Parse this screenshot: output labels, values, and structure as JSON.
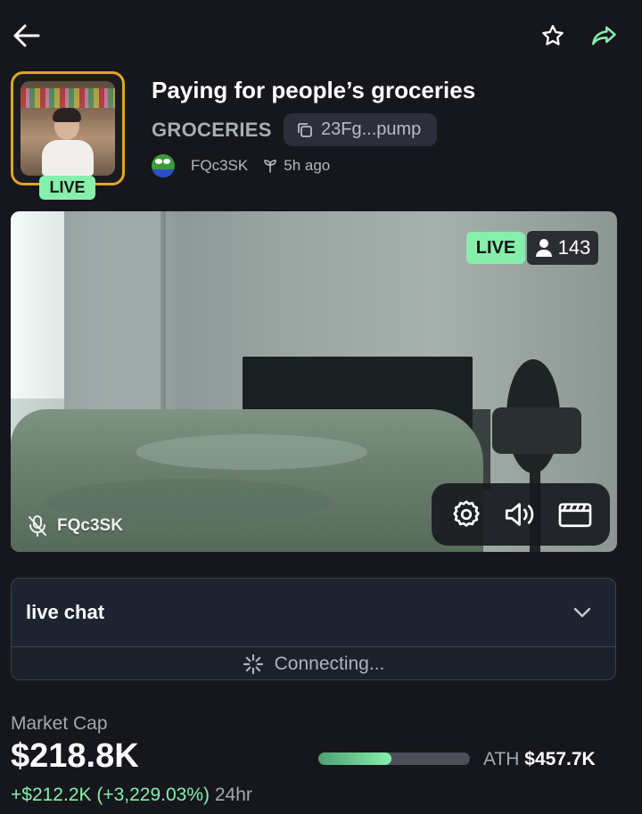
{
  "colors": {
    "accent_green": "#86efac",
    "background": "#16171c",
    "avatar_border": "#e0a429"
  },
  "topbar": {
    "back_icon": "arrow-left-icon",
    "favorite_icon": "star-icon",
    "share_icon": "share-arrow-icon"
  },
  "stream": {
    "title": "Paying for people’s groceries",
    "ticker": "GROCERIES",
    "contract_short": "23Fg...pump",
    "creator": "FQc3SK",
    "age": "5h ago",
    "avatar_live_label": "LIVE"
  },
  "video": {
    "live_label": "LIVE",
    "viewer_count": "143",
    "streamer_label": "FQc3SK",
    "mic_icon": "mic-off-icon",
    "controls": {
      "settings_icon": "gear-icon",
      "volume_icon": "speaker-icon",
      "theater_icon": "clapperboard-icon"
    }
  },
  "chat": {
    "title": "live chat",
    "status": "Connecting..."
  },
  "market": {
    "label": "Market Cap",
    "value": "$218.8K",
    "change": "+$212.2K (+3,229.03%)",
    "period": "24hr",
    "ath_label": "ATH",
    "ath_value": "$457.7K",
    "progress_to_ath": 0.48
  }
}
